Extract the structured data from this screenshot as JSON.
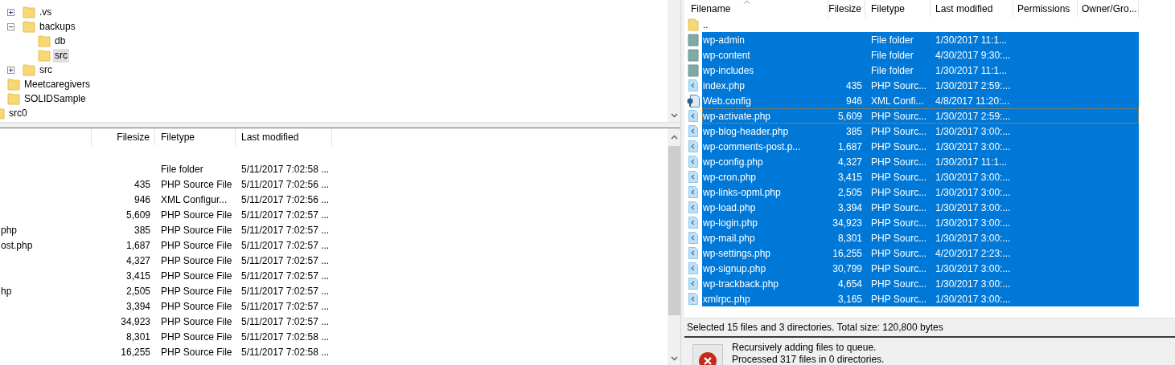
{
  "local_tree": {
    "nodes": [
      {
        "children": [
          {
            "children": [
              {
                "label": ".vs",
                "expanded": false,
                "selected": false
              },
              {
                "label": "backups",
                "expanded": true,
                "selected": false,
                "children": [
                  {
                    "label": "db",
                    "selected": false
                  },
                  {
                    "label": "src",
                    "selected": true
                  }
                ]
              },
              {
                "label": "src",
                "expanded": false,
                "selected": false
              }
            ]
          },
          {
            "label": "Meetcaregivers",
            "selected": false
          },
          {
            "label": "SOLIDSample",
            "selected": false
          }
        ]
      },
      {
        "label": "src0",
        "selected": false
      }
    ]
  },
  "local_list": {
    "columns": [
      "Filesize",
      "Filetype",
      "Last modified"
    ],
    "rows": [
      {
        "name": "",
        "size": "",
        "type": "",
        "modified": ""
      },
      {
        "name": "",
        "size": "",
        "type": "File folder",
        "modified": "5/11/2017 7:02:58 ..."
      },
      {
        "name": "",
        "size": "435",
        "type": "PHP Source File",
        "modified": "5/11/2017 7:02:56 ..."
      },
      {
        "name": "",
        "size": "946",
        "type": "XML Configur...",
        "modified": "5/11/2017 7:02:56 ..."
      },
      {
        "name": "",
        "size": "5,609",
        "type": "PHP Source File",
        "modified": "5/11/2017 7:02:57 ..."
      },
      {
        "name": "php",
        "size": "385",
        "type": "PHP Source File",
        "modified": "5/11/2017 7:02:57 ..."
      },
      {
        "name": "ost.php",
        "size": "1,687",
        "type": "PHP Source File",
        "modified": "5/11/2017 7:02:57 ..."
      },
      {
        "name": "",
        "size": "4,327",
        "type": "PHP Source File",
        "modified": "5/11/2017 7:02:57 ..."
      },
      {
        "name": "",
        "size": "3,415",
        "type": "PHP Source File",
        "modified": "5/11/2017 7:02:57 ..."
      },
      {
        "name": "hp",
        "size": "2,505",
        "type": "PHP Source File",
        "modified": "5/11/2017 7:02:57 ..."
      },
      {
        "name": "",
        "size": "3,394",
        "type": "PHP Source File",
        "modified": "5/11/2017 7:02:57 ..."
      },
      {
        "name": "",
        "size": "34,923",
        "type": "PHP Source File",
        "modified": "5/11/2017 7:02:57 ..."
      },
      {
        "name": "",
        "size": "8,301",
        "type": "PHP Source File",
        "modified": "5/11/2017 7:02:58 ..."
      },
      {
        "name": "",
        "size": "16,255",
        "type": "PHP Source File",
        "modified": "5/11/2017 7:02:58 ..."
      }
    ]
  },
  "remote_list": {
    "columns": [
      "Filename",
      "Filesize",
      "Filetype",
      "Last modified",
      "Permissions",
      "Owner/Gro..."
    ],
    "rows": [
      {
        "kind": "parent",
        "name": "..",
        "size": "",
        "type": "",
        "modified": "",
        "selected": false,
        "focused": false
      },
      {
        "kind": "folder",
        "name": "wp-admin",
        "size": "",
        "type": "File folder",
        "modified": "1/30/2017 11:1...",
        "selected": true,
        "focused": false
      },
      {
        "kind": "folder",
        "name": "wp-content",
        "size": "",
        "type": "File folder",
        "modified": "4/30/2017 9:30:...",
        "selected": true,
        "focused": false
      },
      {
        "kind": "folder",
        "name": "wp-includes",
        "size": "",
        "type": "File folder",
        "modified": "1/30/2017 11:1...",
        "selected": true,
        "focused": false
      },
      {
        "kind": "php",
        "name": "index.php",
        "size": "435",
        "type": "PHP Sourc...",
        "modified": "1/30/2017 2:59:...",
        "selected": true,
        "focused": false
      },
      {
        "kind": "config",
        "name": "Web.config",
        "size": "946",
        "type": "XML Confi...",
        "modified": "4/8/2017 11:20:...",
        "selected": true,
        "focused": false
      },
      {
        "kind": "php",
        "name": "wp-activate.php",
        "size": "5,609",
        "type": "PHP Sourc...",
        "modified": "1/30/2017 2:59:...",
        "selected": true,
        "focused": true
      },
      {
        "kind": "php",
        "name": "wp-blog-header.php",
        "size": "385",
        "type": "PHP Sourc...",
        "modified": "1/30/2017 3:00:...",
        "selected": true,
        "focused": false
      },
      {
        "kind": "php",
        "name": "wp-comments-post.p...",
        "size": "1,687",
        "type": "PHP Sourc...",
        "modified": "1/30/2017 3:00:...",
        "selected": true,
        "focused": false
      },
      {
        "kind": "php",
        "name": "wp-config.php",
        "size": "4,327",
        "type": "PHP Sourc...",
        "modified": "1/30/2017 11:1...",
        "selected": true,
        "focused": false
      },
      {
        "kind": "php",
        "name": "wp-cron.php",
        "size": "3,415",
        "type": "PHP Sourc...",
        "modified": "1/30/2017 3:00:...",
        "selected": true,
        "focused": false
      },
      {
        "kind": "php",
        "name": "wp-links-opml.php",
        "size": "2,505",
        "type": "PHP Sourc...",
        "modified": "1/30/2017 3:00:...",
        "selected": true,
        "focused": false
      },
      {
        "kind": "php",
        "name": "wp-load.php",
        "size": "3,394",
        "type": "PHP Sourc...",
        "modified": "1/30/2017 3:00:...",
        "selected": true,
        "focused": false
      },
      {
        "kind": "php",
        "name": "wp-login.php",
        "size": "34,923",
        "type": "PHP Sourc...",
        "modified": "1/30/2017 3:00:...",
        "selected": true,
        "focused": false
      },
      {
        "kind": "php",
        "name": "wp-mail.php",
        "size": "8,301",
        "type": "PHP Sourc...",
        "modified": "1/30/2017 3:00:...",
        "selected": true,
        "focused": false
      },
      {
        "kind": "php",
        "name": "wp-settings.php",
        "size": "16,255",
        "type": "PHP Sourc...",
        "modified": "4/20/2017 2:23:...",
        "selected": true,
        "focused": false
      },
      {
        "kind": "php",
        "name": "wp-signup.php",
        "size": "30,799",
        "type": "PHP Sourc...",
        "modified": "1/30/2017 3:00:...",
        "selected": true,
        "focused": false
      },
      {
        "kind": "php",
        "name": "wp-trackback.php",
        "size": "4,654",
        "type": "PHP Sourc...",
        "modified": "1/30/2017 3:00:...",
        "selected": true,
        "focused": false
      },
      {
        "kind": "php",
        "name": "xmlrpc.php",
        "size": "3,165",
        "type": "PHP Sourc...",
        "modified": "1/30/2017 3:00:...",
        "selected": true,
        "focused": false
      }
    ]
  },
  "status_bar": "Selected 15 files and 3 directories. Total size: 120,800 bytes",
  "log": {
    "messages": [
      "Recursively adding files to queue.",
      "Processed 317 files in 0 directories."
    ]
  }
}
